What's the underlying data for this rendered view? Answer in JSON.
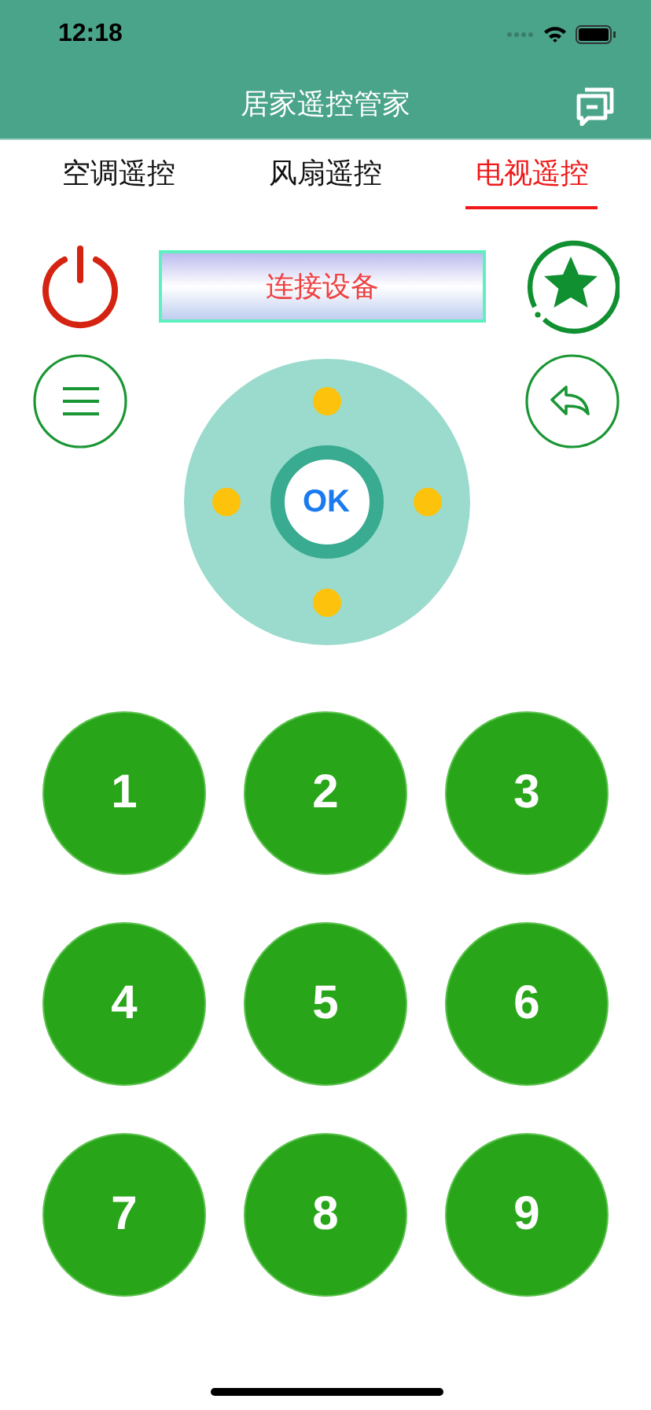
{
  "status_bar": {
    "time": "12:18"
  },
  "nav": {
    "title": "居家遥控管家"
  },
  "tabs": [
    {
      "label": "空调遥控",
      "selected": false
    },
    {
      "label": "风扇遥控",
      "selected": false
    },
    {
      "label": "电视遥控",
      "selected": true
    }
  ],
  "connect_button": {
    "label": "连接设备"
  },
  "dpad": {
    "ok_label": "OK"
  },
  "keypad": [
    "1",
    "2",
    "3",
    "4",
    "5",
    "6",
    "7",
    "8",
    "9"
  ]
}
